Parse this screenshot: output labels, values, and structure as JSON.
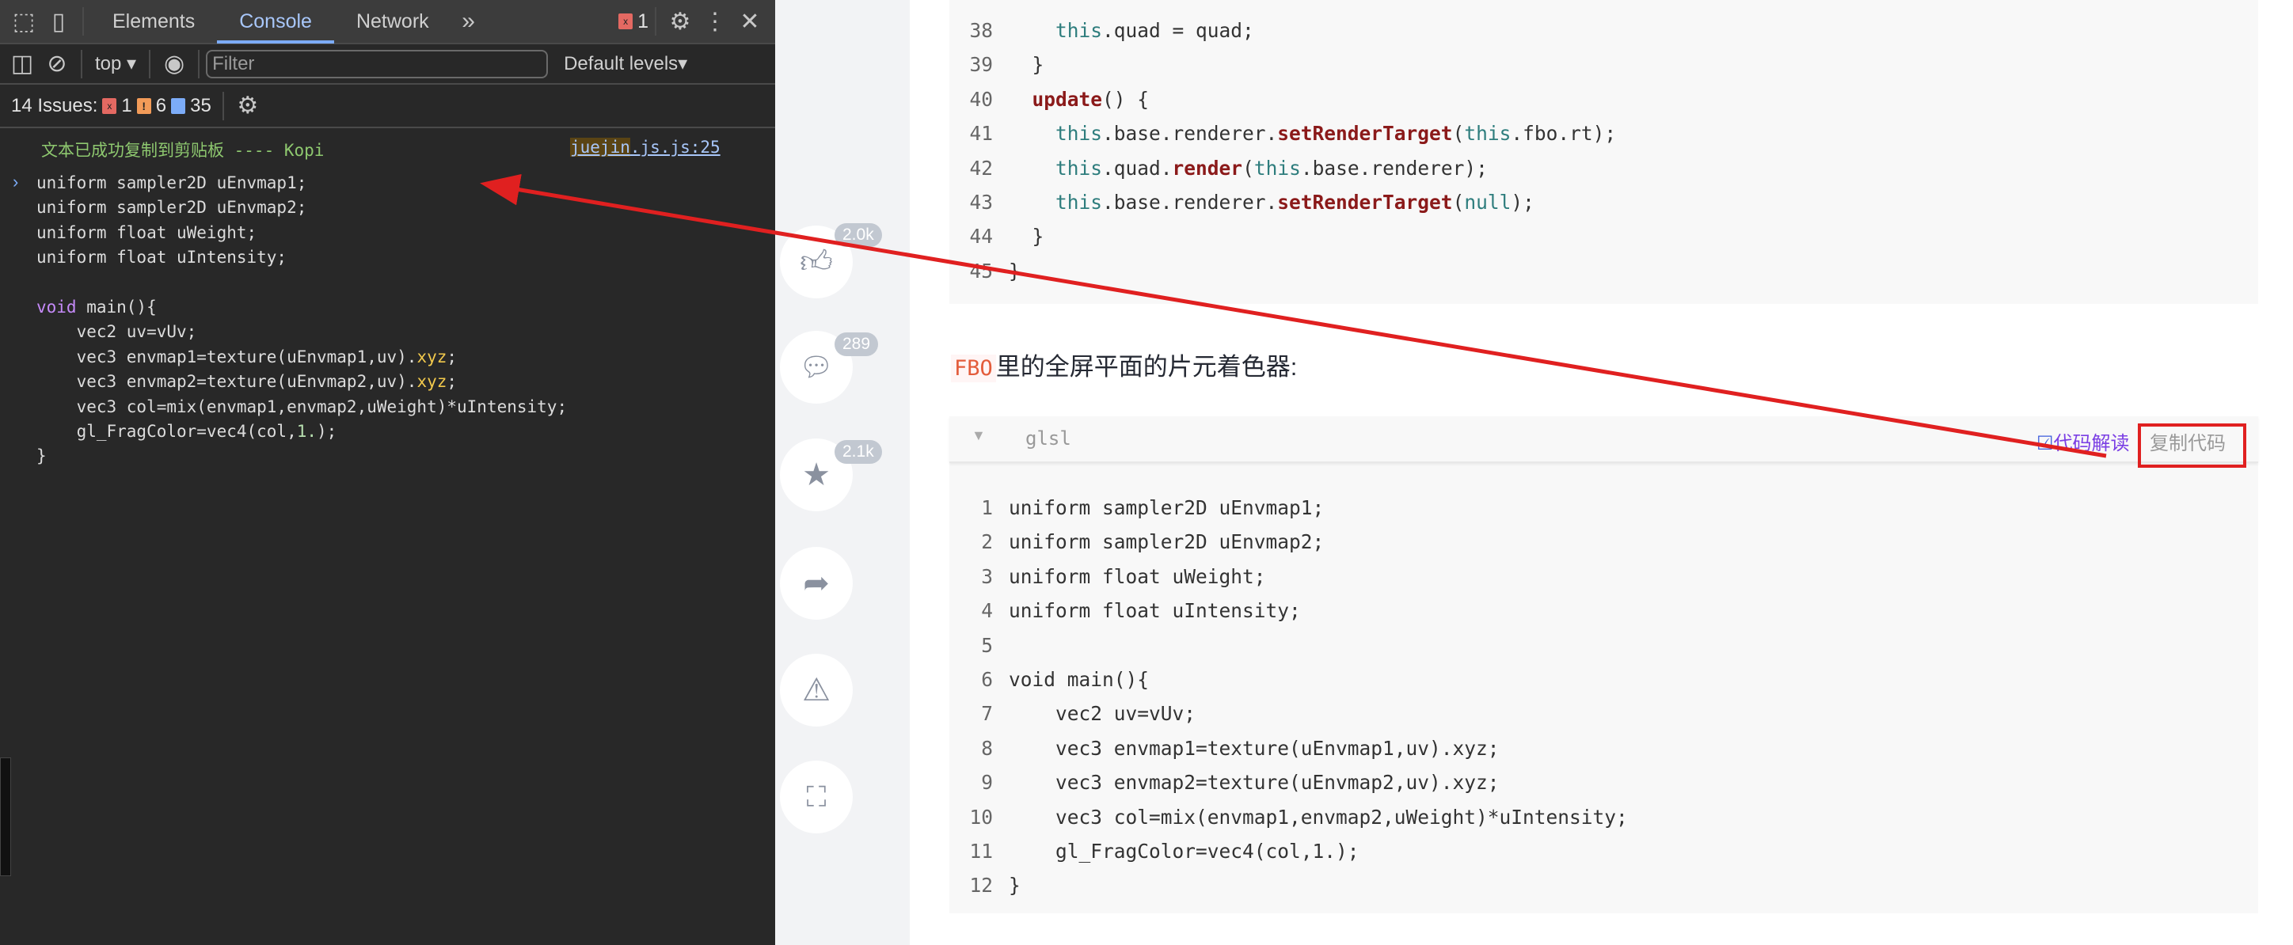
{
  "devtools": {
    "tabs": [
      "Elements",
      "Console",
      "Network"
    ],
    "active_tab": "Console",
    "error_count": "1",
    "context": "top",
    "filter_placeholder": "Filter",
    "levels": "Default levels",
    "issues": {
      "label": "14 Issues:",
      "errors": "1",
      "warnings": "6",
      "info": "35"
    },
    "message": {
      "text": "文本已成功复制到剪贴板 ---- Kopi",
      "source_hl": "juejin",
      "source_rest": ".js.js:25"
    },
    "output": [
      [
        [
          "uniform sampler2D uEnvmap1;",
          ""
        ]
      ],
      [
        [
          "uniform sampler2D uEnvmap2;",
          ""
        ]
      ],
      [
        [
          "uniform float uWeight;",
          ""
        ]
      ],
      [
        [
          "uniform float uIntensity;",
          ""
        ]
      ],
      [
        [
          "",
          ""
        ]
      ],
      [
        [
          "void",
          "kw"
        ],
        [
          " main(){",
          ""
        ]
      ],
      [
        [
          "    vec2 uv=vUv;",
          ""
        ]
      ],
      [
        [
          "    vec3 envmap1=texture(uEnvmap1,uv).",
          ""
        ],
        [
          "xyz",
          "yl"
        ],
        [
          ";",
          ""
        ]
      ],
      [
        [
          "    vec3 envmap2=texture(uEnvmap2,uv).",
          ""
        ],
        [
          "xyz",
          "yl"
        ],
        [
          ";",
          ""
        ]
      ],
      [
        [
          "    vec3 col=mix(envmap1,envmap2,uWeight)*uIntensity;",
          ""
        ]
      ],
      [
        [
          "    gl_FragColor=vec4(col,",
          ""
        ],
        [
          "1.",
          "nm"
        ],
        [
          ");",
          ""
        ]
      ],
      [
        [
          "}",
          ""
        ]
      ]
    ]
  },
  "sidebar": {
    "like_count": "2.0k",
    "comment_count": "289",
    "collect_count": "2.1k"
  },
  "article": {
    "code1": [
      {
        "n": "38",
        "s": [
          [
            "    ",
            ""
          ],
          [
            "this",
            "th"
          ],
          [
            ".quad = quad;",
            ""
          ]
        ]
      },
      {
        "n": "39",
        "s": [
          [
            "  }",
            ""
          ]
        ]
      },
      {
        "n": "40",
        "s": [
          [
            "  ",
            ""
          ],
          [
            "update",
            "fn"
          ],
          [
            "() {",
            ""
          ]
        ]
      },
      {
        "n": "41",
        "s": [
          [
            "    ",
            ""
          ],
          [
            "this",
            "th"
          ],
          [
            ".base.renderer.",
            ""
          ],
          [
            "setRenderTarget",
            "fn"
          ],
          [
            "(",
            ""
          ],
          [
            "this",
            "th"
          ],
          [
            ".fbo.rt);",
            ""
          ]
        ]
      },
      {
        "n": "42",
        "s": [
          [
            "    ",
            ""
          ],
          [
            "this",
            "th"
          ],
          [
            ".quad.",
            ""
          ],
          [
            "render",
            "fn"
          ],
          [
            "(",
            ""
          ],
          [
            "this",
            "th"
          ],
          [
            ".base.renderer);",
            ""
          ]
        ]
      },
      {
        "n": "43",
        "s": [
          [
            "    ",
            ""
          ],
          [
            "this",
            "th"
          ],
          [
            ".base.renderer.",
            ""
          ],
          [
            "setRenderTarget",
            "fn"
          ],
          [
            "(",
            ""
          ],
          [
            "null",
            "th"
          ],
          [
            ");",
            ""
          ]
        ]
      },
      {
        "n": "44",
        "s": [
          [
            "  }",
            ""
          ]
        ]
      },
      {
        "n": "45",
        "s": [
          [
            "}",
            ""
          ]
        ]
      }
    ],
    "heading_code": "FBO",
    "heading_text": "里的全屏平面的片元着色器:",
    "lang": "glsl",
    "explain_label": "代码解读",
    "copy_label": "复制代码",
    "code2": [
      {
        "n": "1",
        "s": [
          [
            "uniform sampler2D uEnvmap1;",
            ""
          ]
        ]
      },
      {
        "n": "2",
        "s": [
          [
            "uniform sampler2D uEnvmap2;",
            ""
          ]
        ]
      },
      {
        "n": "3",
        "s": [
          [
            "uniform float uWeight;",
            ""
          ]
        ]
      },
      {
        "n": "4",
        "s": [
          [
            "uniform float uIntensity;",
            ""
          ]
        ]
      },
      {
        "n": "5",
        "s": [
          [
            "",
            ""
          ]
        ]
      },
      {
        "n": "6",
        "s": [
          [
            "void main(){",
            ""
          ]
        ]
      },
      {
        "n": "7",
        "s": [
          [
            "    vec2 uv=vUv;",
            ""
          ]
        ]
      },
      {
        "n": "8",
        "s": [
          [
            "    vec3 envmap1=texture(uEnvmap1,uv).xyz;",
            ""
          ]
        ]
      },
      {
        "n": "9",
        "s": [
          [
            "    vec3 envmap2=texture(uEnvmap2,uv).xyz;",
            ""
          ]
        ]
      },
      {
        "n": "10",
        "s": [
          [
            "    vec3 col=mix(envmap1,envmap2,uWeight)*uIntensity;",
            ""
          ]
        ]
      },
      {
        "n": "11",
        "s": [
          [
            "    gl_FragColor=vec4(col,1.);",
            ""
          ]
        ]
      },
      {
        "n": "12",
        "s": [
          [
            "}",
            ""
          ]
        ]
      }
    ]
  },
  "colors": {
    "annotation": "#e02020",
    "accent": "#7cacf8"
  }
}
